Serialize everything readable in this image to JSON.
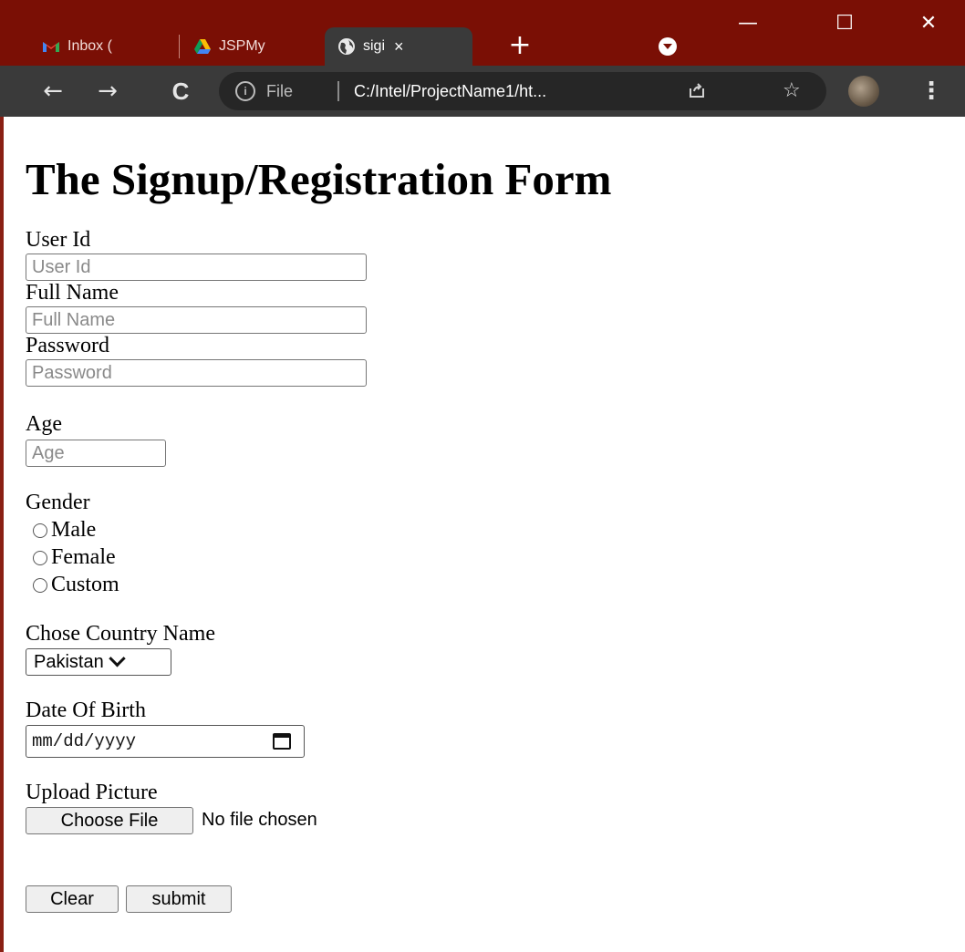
{
  "browser": {
    "tabs": [
      {
        "label": "Inbox (",
        "icon": "gmail-icon"
      },
      {
        "label": "JSPMy",
        "icon": "google-drive-icon"
      },
      {
        "label": "sigi",
        "icon": "globe-icon",
        "active": true,
        "close": "×"
      }
    ],
    "new_tab": "+",
    "window_controls": {
      "minimize": "—",
      "maximize": "☐",
      "close": "✕"
    },
    "nav": {
      "back": "←",
      "forward": "→",
      "reload": "C"
    },
    "address": {
      "info": "i",
      "scheme_label": "File",
      "url": "C:/Intel/ProjectName1/ht..."
    },
    "star": "☆",
    "menu": "⋮"
  },
  "form": {
    "title": "The Signup/Registration Form",
    "user_id": {
      "label": "User Id",
      "placeholder": "User Id"
    },
    "full_name": {
      "label": "Full Name",
      "placeholder": "Full Name"
    },
    "password": {
      "label": "Password",
      "placeholder": "Password"
    },
    "age": {
      "label": "Age",
      "placeholder": "Age"
    },
    "gender": {
      "label": "Gender",
      "options": [
        "Male",
        "Female",
        "Custom"
      ]
    },
    "country": {
      "label": "Chose Country Name",
      "selected": "Pakistan"
    },
    "dob": {
      "label": "Date Of Birth",
      "placeholder": "mm/dd/yyyy"
    },
    "picture": {
      "label": "Upload Picture",
      "button": "Choose File",
      "status": "No file chosen"
    },
    "clear_label": "Clear",
    "submit_label": "submit"
  }
}
